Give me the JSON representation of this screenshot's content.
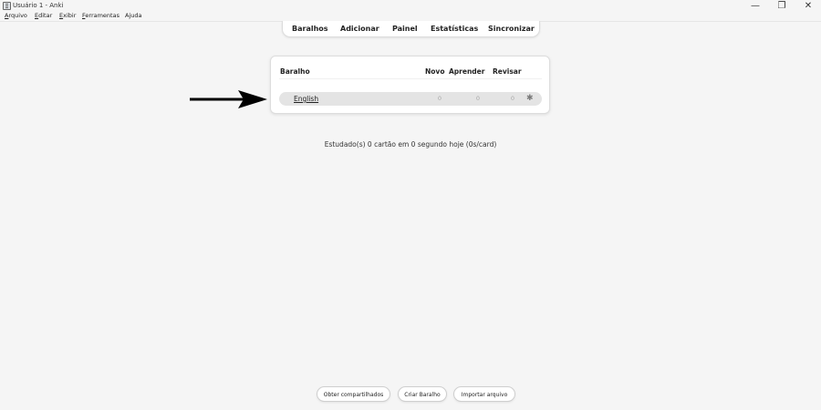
{
  "window": {
    "title": "Usuário 1 - Anki",
    "controls": {
      "minimize": "—",
      "maximize": "❐",
      "close": "✕"
    }
  },
  "menubar": {
    "items": [
      {
        "accel": "A",
        "rest": "rquivo"
      },
      {
        "accel": "E",
        "rest": "ditar"
      },
      {
        "accel": "E",
        "rest": "xibir"
      },
      {
        "accel": "F",
        "rest": "erramentas"
      },
      {
        "accel": "",
        "rest": "Ajuda"
      }
    ]
  },
  "topnav": {
    "items": [
      "Baralhos",
      "Adicionar",
      "Painel",
      "Estatísticas",
      "Sincronizar"
    ]
  },
  "deck_table": {
    "headers": {
      "deck": "Baralho",
      "new": "Novo",
      "learn": "Aprender",
      "review": "Revisar"
    },
    "rows": [
      {
        "name": "English",
        "new": "0",
        "learn": "0",
        "review": "0",
        "options_icon": "gear-icon"
      }
    ]
  },
  "study_stats": "Estudado(s) 0 cartão em 0 segundo hoje (0s/card)",
  "bottom_buttons": {
    "get_shared": "Obter compartilhados",
    "create_deck": "Criar Baralho",
    "import_file": "Importar arquivo"
  },
  "colors": {
    "background": "#f5f5f5",
    "card": "#ffffff",
    "row_highlight": "#e4e4e4",
    "muted_count": "#a8a8a8",
    "arrow": "#000000"
  }
}
